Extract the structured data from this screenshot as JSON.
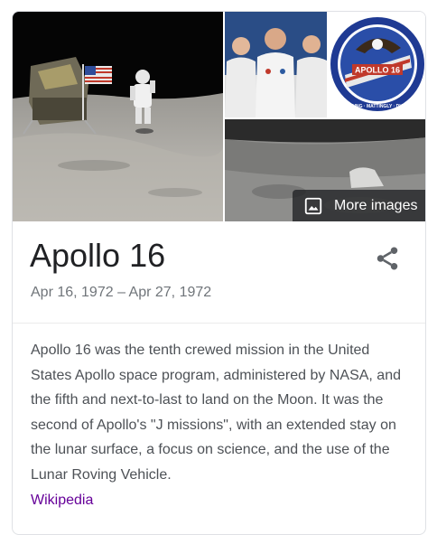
{
  "images": {
    "main_alt": "Astronaut on the lunar surface",
    "crew_alt": "Apollo 16 crew",
    "patch_alt": "Apollo 16 mission patch",
    "surface_alt": "Lunar surface",
    "patch_text": "APOLLO 16",
    "patch_names": "YOUNG · MATTINGLY · DUKE",
    "more_images_label": "More images"
  },
  "header": {
    "title": "Apollo 16",
    "dates": "Apr 16, 1972 – Apr 27, 1972"
  },
  "description": {
    "text": "Apollo 16 was the tenth crewed mission in the United States Apollo space program, administered by NASA, and the fifth and next-to-last to land on the Moon. It was the second of Apollo's \"J missions\", with an extended stay on the lunar surface, a focus on science, and the use of the Lunar Roving Vehicle.",
    "source_label": "Wikipedia"
  },
  "icons": {
    "more_images": "photo-icon",
    "share": "share-icon"
  },
  "colors": {
    "title": "#202124",
    "secondary_text": "#70757a",
    "body_text": "#4d5156",
    "source_link": "#660099",
    "overlay": "#202124"
  }
}
